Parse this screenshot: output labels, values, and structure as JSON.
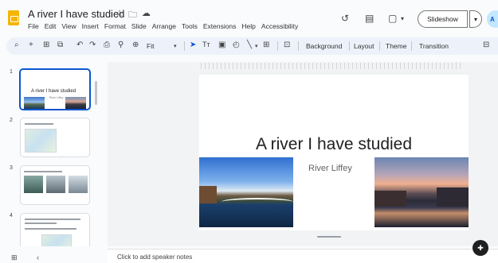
{
  "header": {
    "doc_title": "A river I have studied",
    "title_icons": [
      "star-icon",
      "folder-move-icon",
      "cloud-saved-icon"
    ],
    "menu": [
      "File",
      "Edit",
      "View",
      "Insert",
      "Format",
      "Slide",
      "Arrange",
      "Tools",
      "Extensions",
      "Help",
      "Accessibility"
    ],
    "history_icon": "↺",
    "comments_icon": "▤",
    "meet_icon": "▢",
    "slideshow_label": "Slideshow",
    "avatar_initials": "A"
  },
  "toolbar": {
    "zoom_label": "Fit",
    "background_label": "Background",
    "layout_label": "Layout",
    "theme_label": "Theme",
    "transition_label": "Transition"
  },
  "filmstrip": {
    "slides": [
      {
        "number": "1",
        "title": "A river I have studied",
        "subtitle": "River Liffey"
      },
      {
        "number": "2"
      },
      {
        "number": "3"
      },
      {
        "number": "4"
      }
    ]
  },
  "slide": {
    "title": "A river I have studied",
    "subtitle": "River Liffey"
  },
  "notes": {
    "placeholder": "Click to add speaker notes"
  }
}
